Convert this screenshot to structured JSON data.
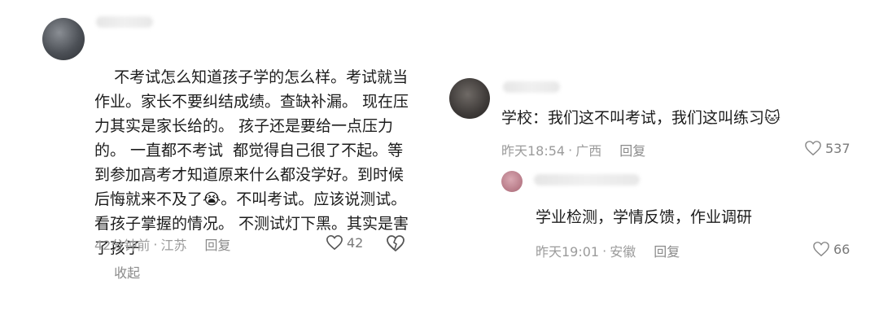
{
  "comment1": {
    "text": "不考试怎么知道孩子学的怎么样。考试就当作业。家长不要纠结成绩。查缺补漏。 现在压力其实是家长给的。 孩子还是要给一点压力的。 一直都不考试  都觉得自己很了不起。等到参加高考才知道原来什么都没学好。到时候后悔就来不及了😭。不叫考试。应该说测试。看孩子掌握的情况。 不测试灯下黑。其实是害了孩子",
    "collapse": "收起",
    "time": "42分钟前",
    "location": "江苏",
    "reply": "回复",
    "likes": "42"
  },
  "comment2": {
    "text": "学校：我们这不叫考试，我们这叫练习🐱",
    "time": "昨天18:54",
    "location": "广西",
    "reply": "回复",
    "likes": "537"
  },
  "comment3": {
    "text": "学业检测，学情反馈，作业调研",
    "time": "昨天19:01",
    "location": "安徽",
    "reply": "回复",
    "likes": "66"
  },
  "separator": "·",
  "icons": [
    "heart-icon",
    "dislike-heart-icon",
    "avatar"
  ]
}
